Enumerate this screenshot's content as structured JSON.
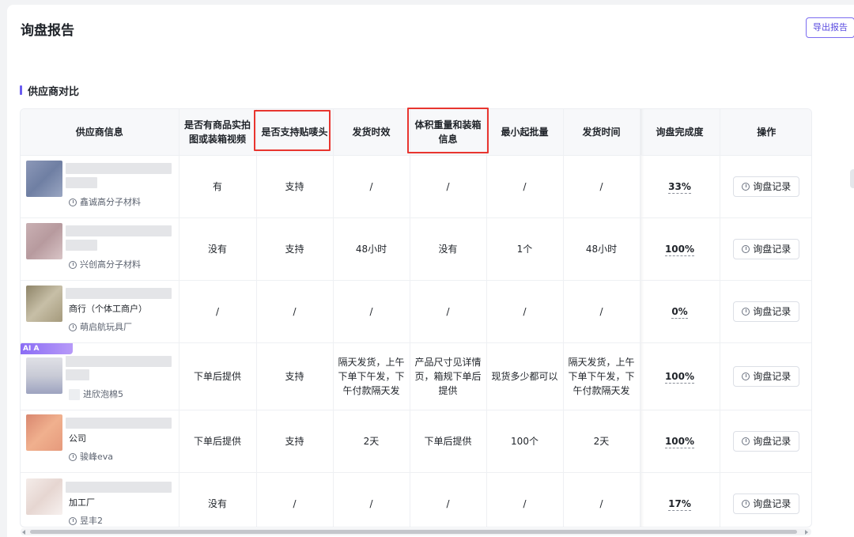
{
  "header": {
    "title": "询盘报告",
    "export_label": "导出报告"
  },
  "section": {
    "title": "供应商对比"
  },
  "columns": [
    "供应商信息",
    "是否有商品实拍图或装箱视频",
    "是否支持贴唛头",
    "发货时效",
    "体积重量和装箱信息",
    "最小起批量",
    "发货时间",
    "询盘完成度",
    "操作"
  ],
  "record_label": "询盘记录",
  "rows": [
    {
      "name": "",
      "shop": "鑫诚高分子材料",
      "ai_tag": "",
      "photo": "有",
      "label": "支持",
      "ship_speed": "/",
      "packing": "/",
      "moq": "/",
      "ship_time": "/",
      "completion": "33%"
    },
    {
      "name": "",
      "shop": "兴创高分子材料",
      "ai_tag": "",
      "photo": "没有",
      "label": "支持",
      "ship_speed": "48小时",
      "packing": "没有",
      "moq": "1个",
      "ship_time": "48小时",
      "completion": "100%"
    },
    {
      "name": "商行（个体工商户）",
      "shop": "萌启航玩具厂",
      "ai_tag": "",
      "photo": "/",
      "label": "/",
      "ship_speed": "/",
      "packing": "/",
      "moq": "/",
      "ship_time": "/",
      "completion": "0%"
    },
    {
      "name": "",
      "shop": "进欣泡棉5",
      "ai_tag": "AI A",
      "photo": "下单后提供",
      "label": "支持",
      "ship_speed": "隔天发货，上午下单下午发，下午付款隔天发",
      "packing": "产品尺寸见详情页，箱规下单后提供",
      "moq": "现货多少都可以",
      "ship_time": "隔天发货，上午下单下午发，下午付款隔天发",
      "completion": "100%"
    },
    {
      "name": "公司",
      "shop": "骏峰eva",
      "ai_tag": "",
      "photo": "下单后提供",
      "label": "支持",
      "ship_speed": "2天",
      "packing": "下单后提供",
      "moq": "100个",
      "ship_time": "2天",
      "completion": "100%"
    },
    {
      "name": "加工厂",
      "shop": "昱丰2",
      "ai_tag": "",
      "photo": "没有",
      "label": "/",
      "ship_speed": "/",
      "packing": "/",
      "moq": "/",
      "ship_time": "/",
      "completion": "17%"
    }
  ],
  "colors": {
    "accent": "#6a5cf0",
    "highlight": "#e8352f"
  }
}
